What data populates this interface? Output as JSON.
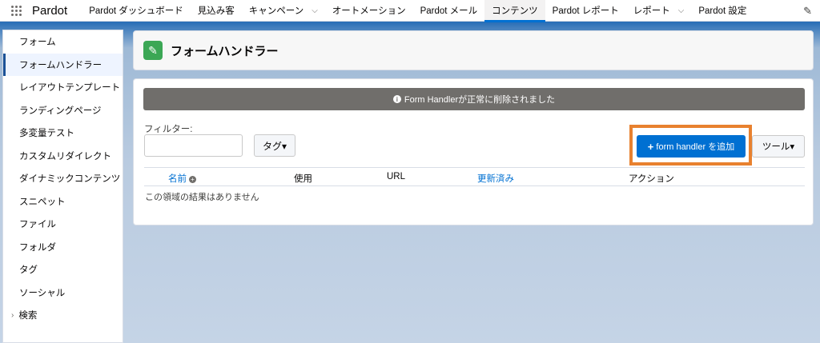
{
  "topnav": {
    "app_name": "Pardot",
    "items": [
      {
        "label": "Pardot ダッシュボード",
        "chevron": false
      },
      {
        "label": "見込み客",
        "chevron": false
      },
      {
        "label": "キャンペーン",
        "chevron": true
      },
      {
        "label": "オートメーション",
        "chevron": false
      },
      {
        "label": "Pardot メール",
        "chevron": false
      },
      {
        "label": "コンテンツ",
        "chevron": false,
        "active": true
      },
      {
        "label": "Pardot レポート",
        "chevron": false
      },
      {
        "label": "レポート",
        "chevron": true
      },
      {
        "label": "Pardot 設定",
        "chevron": false
      }
    ],
    "edit_icon": "pencil-icon"
  },
  "sidebar": {
    "items": [
      {
        "label": "フォーム"
      },
      {
        "label": "フォームハンドラー",
        "active": true
      },
      {
        "label": "レイアウトテンプレート"
      },
      {
        "label": "ランディングページ"
      },
      {
        "label": "多変量テスト"
      },
      {
        "label": "カスタムリダイレクト"
      },
      {
        "label": "ダイナミックコンテンツ"
      },
      {
        "label": "スニペット"
      },
      {
        "label": "ファイル"
      },
      {
        "label": "フォルダ"
      },
      {
        "label": "タグ"
      },
      {
        "label": "ソーシャル"
      },
      {
        "label": "検索",
        "expandable": true
      }
    ]
  },
  "header": {
    "title": "フォームハンドラー",
    "icon": "form-handler-icon"
  },
  "alert": {
    "message": "Form Handlerが正常に削除されました"
  },
  "filter": {
    "label": "フィルター:",
    "value": "",
    "tag_button": "タグ▾"
  },
  "actions": {
    "add_button": "form handler を追加",
    "tools_button": "ツール▾"
  },
  "table": {
    "columns": [
      "名前",
      "使用",
      "URL",
      "更新済み",
      "アクション"
    ],
    "empty_message": "この領域の結果はありません"
  },
  "colors": {
    "brand": "#0070d2",
    "highlight": "#e8812f",
    "alert_bg": "#706e6b",
    "header_icon": "#3ba755"
  }
}
